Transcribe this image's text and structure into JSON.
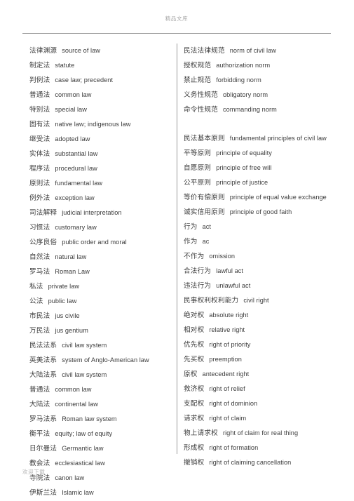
{
  "header": {
    "watermark_title": "精品文库"
  },
  "footer": {
    "download_note": "欢迎下载"
  },
  "document": {
    "type": "chinese-english legal glossary",
    "columns": 2
  },
  "left_column": {
    "entries": [
      {
        "zh": "法律渊源",
        "en": "source of law"
      },
      {
        "zh": "制定法",
        "en": "statute"
      },
      {
        "zh": "判例法",
        "en": "case law; precedent"
      },
      {
        "zh": "普通法",
        "en": "common law"
      },
      {
        "zh": "特别法",
        "en": "special law"
      },
      {
        "zh": "固有法",
        "en": "native law; indigenous law"
      },
      {
        "zh": "继受法",
        "en": "adopted law"
      },
      {
        "zh": "实体法",
        "en": "substantial law"
      },
      {
        "zh": "程序法",
        "en": "procedural law"
      },
      {
        "zh": "原则法",
        "en": "fundamental law"
      },
      {
        "zh": "例外法",
        "en": "exception law"
      },
      {
        "zh": "司法解释",
        "en": "judicial interpretation"
      },
      {
        "zh": "习惯法",
        "en": "customary law"
      },
      {
        "zh": "公序良俗",
        "en": "public order and moral"
      },
      {
        "zh": "自然法",
        "en": "natural law"
      },
      {
        "zh": "罗马法",
        "en": "Roman Law"
      },
      {
        "zh": "私法",
        "en": "private law"
      },
      {
        "zh": "公法",
        "en": "public law"
      },
      {
        "zh": "市民法",
        "en": "jus civile"
      },
      {
        "zh": "万民法",
        "en": "jus gentium"
      },
      {
        "zh": "民法法系",
        "en": "civil law system"
      },
      {
        "zh": "英美法系",
        "en": "system of Anglo-American law"
      },
      {
        "zh": "大陆法系",
        "en": "civil law system"
      },
      {
        "zh": "普通法",
        "en": "common law"
      },
      {
        "zh": "大陆法",
        "en": "continental law"
      },
      {
        "zh": "罗马法系",
        "en": "Roman law system"
      },
      {
        "zh": "衡平法",
        "en": "equity; law of equity"
      },
      {
        "zh": "日尔曼法",
        "en": "Germantic law"
      },
      {
        "zh": "教会法",
        "en": "ecclesiastical law"
      },
      {
        "zh": "寺院法",
        "en": "canon law"
      },
      {
        "zh": "伊斯兰法",
        "en": "Islamic law"
      }
    ]
  },
  "right_column": {
    "entries": [
      {
        "zh": "民法法律规范",
        "en": "norm of civil law"
      },
      {
        "zh": "授权规范",
        "en": "authorization norm"
      },
      {
        "zh": "禁止规范",
        "en": "forbidding norm"
      },
      {
        "zh": "义务性规范",
        "en": "obligatory norm"
      },
      {
        "zh": "命令性规范",
        "en": "commanding norm"
      },
      {
        "zh": "",
        "en": ""
      },
      {
        "zh": "民法基本原则",
        "en": "fundamental principles of civil law"
      },
      {
        "zh": "平等原则",
        "en": "principle of equality"
      },
      {
        "zh": "自愿原则",
        "en": "principle of free will"
      },
      {
        "zh": "公平原则",
        "en": "principle of justice"
      },
      {
        "zh": "等价有偿原则",
        "en": "principle of equal value exchange"
      },
      {
        "zh": "诚实信用原则",
        "en": "principle of good faith"
      },
      {
        "zh": "行为",
        "en": "act"
      },
      {
        "zh": "作为",
        "en": "ac"
      },
      {
        "zh": "不作为",
        "en": "omission"
      },
      {
        "zh": "合法行为",
        "en": "lawful act"
      },
      {
        "zh": "违法行为",
        "en": "unlawful act"
      },
      {
        "zh": "民事权利权利能力",
        "en": "civil right"
      },
      {
        "zh": "绝对权",
        "en": "absolute right"
      },
      {
        "zh": "相对权",
        "en": "relative right"
      },
      {
        "zh": "优先权",
        "en": "right of priority"
      },
      {
        "zh": "先买权",
        "en": "preemption"
      },
      {
        "zh": "原权",
        "en": "antecedent right"
      },
      {
        "zh": "救济权",
        "en": "right of relief"
      },
      {
        "zh": "支配权",
        "en": "right of dominion"
      },
      {
        "zh": "请求权",
        "en": "right of claim"
      },
      {
        "zh": "物上请求权",
        "en": "right of claim for real thing"
      },
      {
        "zh": "形成权",
        "en": "right of formation"
      },
      {
        "zh": "撤销权",
        "en": "right of claiming cancellation"
      }
    ]
  }
}
